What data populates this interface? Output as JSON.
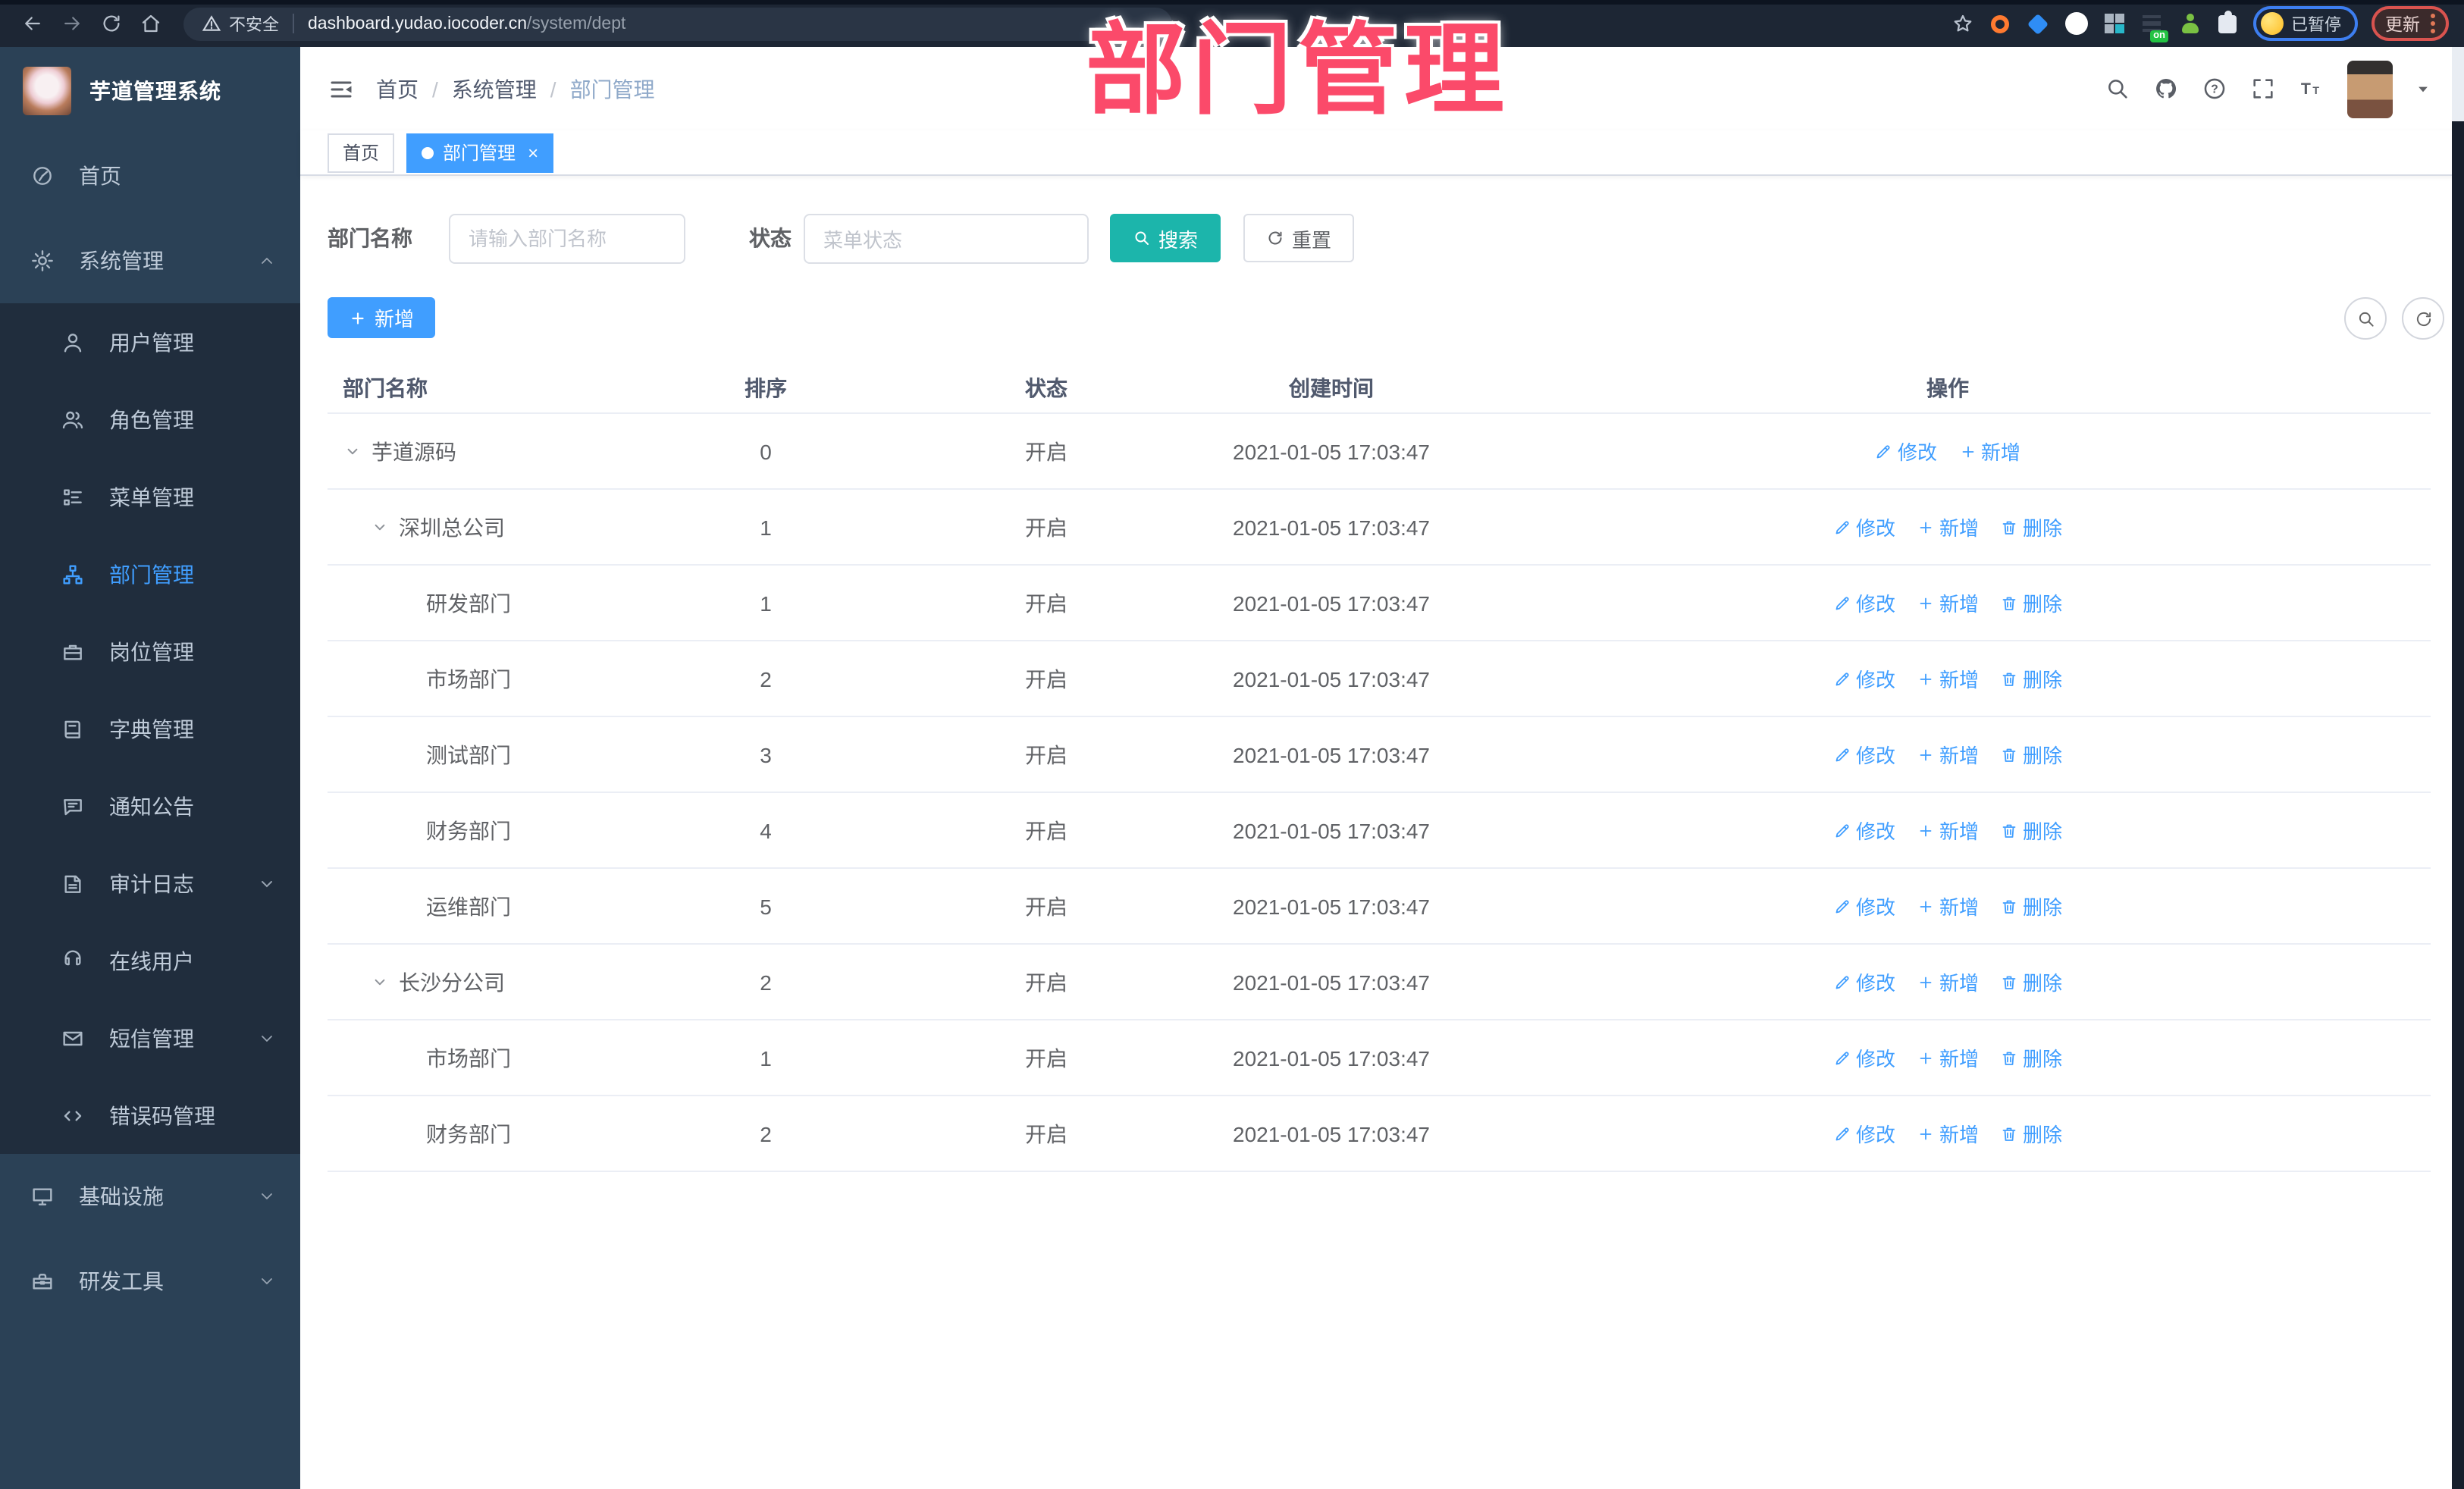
{
  "overlay": {
    "title": "部门管理",
    "color": "#fb4a6a"
  },
  "browser": {
    "nav_icons": [
      "back-icon",
      "forward-icon",
      "reload-icon",
      "home-icon"
    ],
    "secure_label": "不安全",
    "url_host": "dashboard.yudao.iocoder.cn",
    "url_path": "/system/dept",
    "profile_status": "已暂停",
    "update_label": "更新",
    "extensions": [
      {
        "slug": "ext-target",
        "shape": "ring",
        "color": "#ff7a30"
      },
      {
        "slug": "ext-location",
        "shape": "drop",
        "color": "#2f8df5"
      },
      {
        "slug": "ext-check",
        "shape": "gcirc",
        "color": "#25b14b",
        "glyph": "✓"
      },
      {
        "slug": "ext-grid",
        "shape": "grid4",
        "color": "#a9b4c0"
      },
      {
        "slug": "ext-list",
        "shape": "bars",
        "color": "#394251",
        "badge": "on"
      },
      {
        "slug": "ext-person",
        "shape": "personx",
        "color": "#7ac143"
      },
      {
        "slug": "ext-puzzle",
        "shape": "puzzle",
        "color": "#e4e9f1"
      }
    ]
  },
  "sidebar": {
    "title": "芋道管理系统",
    "items": [
      {
        "slug": "home",
        "label": "首页",
        "icon": "dashboard-icon",
        "level": "top"
      },
      {
        "slug": "system-management",
        "label": "系统管理",
        "icon": "gear-icon",
        "level": "top",
        "chevron": "up"
      },
      {
        "slug": "user-management",
        "label": "用户管理",
        "icon": "user-icon",
        "level": "sub"
      },
      {
        "slug": "role-management",
        "label": "角色管理",
        "icon": "users-icon",
        "level": "sub"
      },
      {
        "slug": "menu-management",
        "label": "菜单管理",
        "icon": "menu-list-icon",
        "level": "sub"
      },
      {
        "slug": "dept-management",
        "label": "部门管理",
        "icon": "org-tree-icon",
        "level": "sub",
        "active": true
      },
      {
        "slug": "post-management",
        "label": "岗位管理",
        "icon": "post-icon",
        "level": "sub"
      },
      {
        "slug": "dict-management",
        "label": "字典管理",
        "icon": "dict-icon",
        "level": "sub"
      },
      {
        "slug": "notice",
        "label": "通知公告",
        "icon": "announcement-icon",
        "level": "sub"
      },
      {
        "slug": "audit-log",
        "label": "审计日志",
        "icon": "audit-log-icon",
        "level": "sub",
        "chevron": "down"
      },
      {
        "slug": "online-user",
        "label": "在线用户",
        "icon": "online-user-icon",
        "level": "sub"
      },
      {
        "slug": "sms-management",
        "label": "短信管理",
        "icon": "sms-icon",
        "level": "sub",
        "chevron": "down"
      },
      {
        "slug": "error-code-management",
        "label": "错误码管理",
        "icon": "error-code-icon",
        "level": "sub"
      },
      {
        "slug": "infrastructure",
        "label": "基础设施",
        "icon": "infrastructure-icon",
        "level": "top",
        "chevron": "down"
      },
      {
        "slug": "dev-tools",
        "label": "研发工具",
        "icon": "dev-tools-icon",
        "level": "top",
        "chevron": "down"
      }
    ]
  },
  "header": {
    "breadcrumb": [
      "首页",
      "系统管理",
      "部门管理"
    ],
    "separator": "/",
    "action_icons": [
      "search-icon",
      "github-icon",
      "help-icon",
      "fullscreen-icon",
      "font-size-icon"
    ]
  },
  "tabs": {
    "close_glyph": "×",
    "items": [
      {
        "label": "首页",
        "active": false
      },
      {
        "label": "部门管理",
        "active": true,
        "closable": true
      }
    ]
  },
  "filters": {
    "dept_label": "部门名称",
    "dept_placeholder": "请输入部门名称",
    "status_label": "状态",
    "status_placeholder": "菜单状态",
    "search_label": "搜索",
    "reset_label": "重置"
  },
  "toolbar": {
    "add_label": "新增",
    "circle_buttons": [
      {
        "slug": "toggle-search",
        "icon": "search-icon"
      },
      {
        "slug": "refresh",
        "icon": "refresh-icon"
      }
    ]
  },
  "table": {
    "headers": [
      "部门名称",
      "排序",
      "状态",
      "创建时间",
      "操作"
    ],
    "rows": [
      {
        "name": "芋道源码",
        "level": 0,
        "expandable": true,
        "sort": "0",
        "status": "开启",
        "created": "2021-01-05 17:03:47",
        "actions": [
          {
            "label": "修改",
            "slug": "edit",
            "icon": "edit-icon"
          },
          {
            "label": "新增",
            "slug": "add",
            "icon": "plus-icon"
          }
        ]
      },
      {
        "name": "深圳总公司",
        "level": 1,
        "expandable": true,
        "sort": "1",
        "status": "开启",
        "created": "2021-01-05 17:03:47",
        "actions": [
          {
            "label": "修改",
            "slug": "edit",
            "icon": "edit-icon"
          },
          {
            "label": "新增",
            "slug": "add",
            "icon": "plus-icon"
          },
          {
            "label": "删除",
            "slug": "delete",
            "icon": "delete-icon"
          }
        ]
      },
      {
        "name": "研发部门",
        "level": 2,
        "expandable": false,
        "sort": "1",
        "status": "开启",
        "created": "2021-01-05 17:03:47",
        "actions": [
          {
            "label": "修改",
            "slug": "edit",
            "icon": "edit-icon"
          },
          {
            "label": "新增",
            "slug": "add",
            "icon": "plus-icon"
          },
          {
            "label": "删除",
            "slug": "delete",
            "icon": "delete-icon"
          }
        ]
      },
      {
        "name": "市场部门",
        "level": 2,
        "expandable": false,
        "sort": "2",
        "status": "开启",
        "created": "2021-01-05 17:03:47",
        "actions": [
          {
            "label": "修改",
            "slug": "edit",
            "icon": "edit-icon"
          },
          {
            "label": "新增",
            "slug": "add",
            "icon": "plus-icon"
          },
          {
            "label": "删除",
            "slug": "delete",
            "icon": "delete-icon"
          }
        ]
      },
      {
        "name": "测试部门",
        "level": 2,
        "expandable": false,
        "sort": "3",
        "status": "开启",
        "created": "2021-01-05 17:03:47",
        "actions": [
          {
            "label": "修改",
            "slug": "edit",
            "icon": "edit-icon"
          },
          {
            "label": "新增",
            "slug": "add",
            "icon": "plus-icon"
          },
          {
            "label": "删除",
            "slug": "delete",
            "icon": "delete-icon"
          }
        ]
      },
      {
        "name": "财务部门",
        "level": 2,
        "expandable": false,
        "sort": "4",
        "status": "开启",
        "created": "2021-01-05 17:03:47",
        "actions": [
          {
            "label": "修改",
            "slug": "edit",
            "icon": "edit-icon"
          },
          {
            "label": "新增",
            "slug": "add",
            "icon": "plus-icon"
          },
          {
            "label": "删除",
            "slug": "delete",
            "icon": "delete-icon"
          }
        ]
      },
      {
        "name": "运维部门",
        "level": 2,
        "expandable": false,
        "sort": "5",
        "status": "开启",
        "created": "2021-01-05 17:03:47",
        "actions": [
          {
            "label": "修改",
            "slug": "edit",
            "icon": "edit-icon"
          },
          {
            "label": "新增",
            "slug": "add",
            "icon": "plus-icon"
          },
          {
            "label": "删除",
            "slug": "delete",
            "icon": "delete-icon"
          }
        ]
      },
      {
        "name": "长沙分公司",
        "level": 1,
        "expandable": true,
        "sort": "2",
        "status": "开启",
        "created": "2021-01-05 17:03:47",
        "actions": [
          {
            "label": "修改",
            "slug": "edit",
            "icon": "edit-icon"
          },
          {
            "label": "新增",
            "slug": "add",
            "icon": "plus-icon"
          },
          {
            "label": "删除",
            "slug": "delete",
            "icon": "delete-icon"
          }
        ]
      },
      {
        "name": "市场部门",
        "level": 2,
        "expandable": false,
        "sort": "1",
        "status": "开启",
        "created": "2021-01-05 17:03:47",
        "actions": [
          {
            "label": "修改",
            "slug": "edit",
            "icon": "edit-icon"
          },
          {
            "label": "新增",
            "slug": "add",
            "icon": "plus-icon"
          },
          {
            "label": "删除",
            "slug": "delete",
            "icon": "delete-icon"
          }
        ]
      },
      {
        "name": "财务部门",
        "level": 2,
        "expandable": false,
        "sort": "2",
        "status": "开启",
        "created": "2021-01-05 17:03:47",
        "actions": [
          {
            "label": "修改",
            "slug": "edit",
            "icon": "edit-icon"
          },
          {
            "label": "新增",
            "slug": "add",
            "icon": "plus-icon"
          },
          {
            "label": "删除",
            "slug": "delete",
            "icon": "delete-icon"
          }
        ]
      }
    ]
  },
  "colors": {
    "accent": "#409eff",
    "search_button": "#1cb5ab",
    "overlay_pink": "#fb4a6a",
    "sidebar_bg": "#2b4156",
    "submenu_bg": "#202d3d",
    "browser_bar": "#1d2634"
  }
}
